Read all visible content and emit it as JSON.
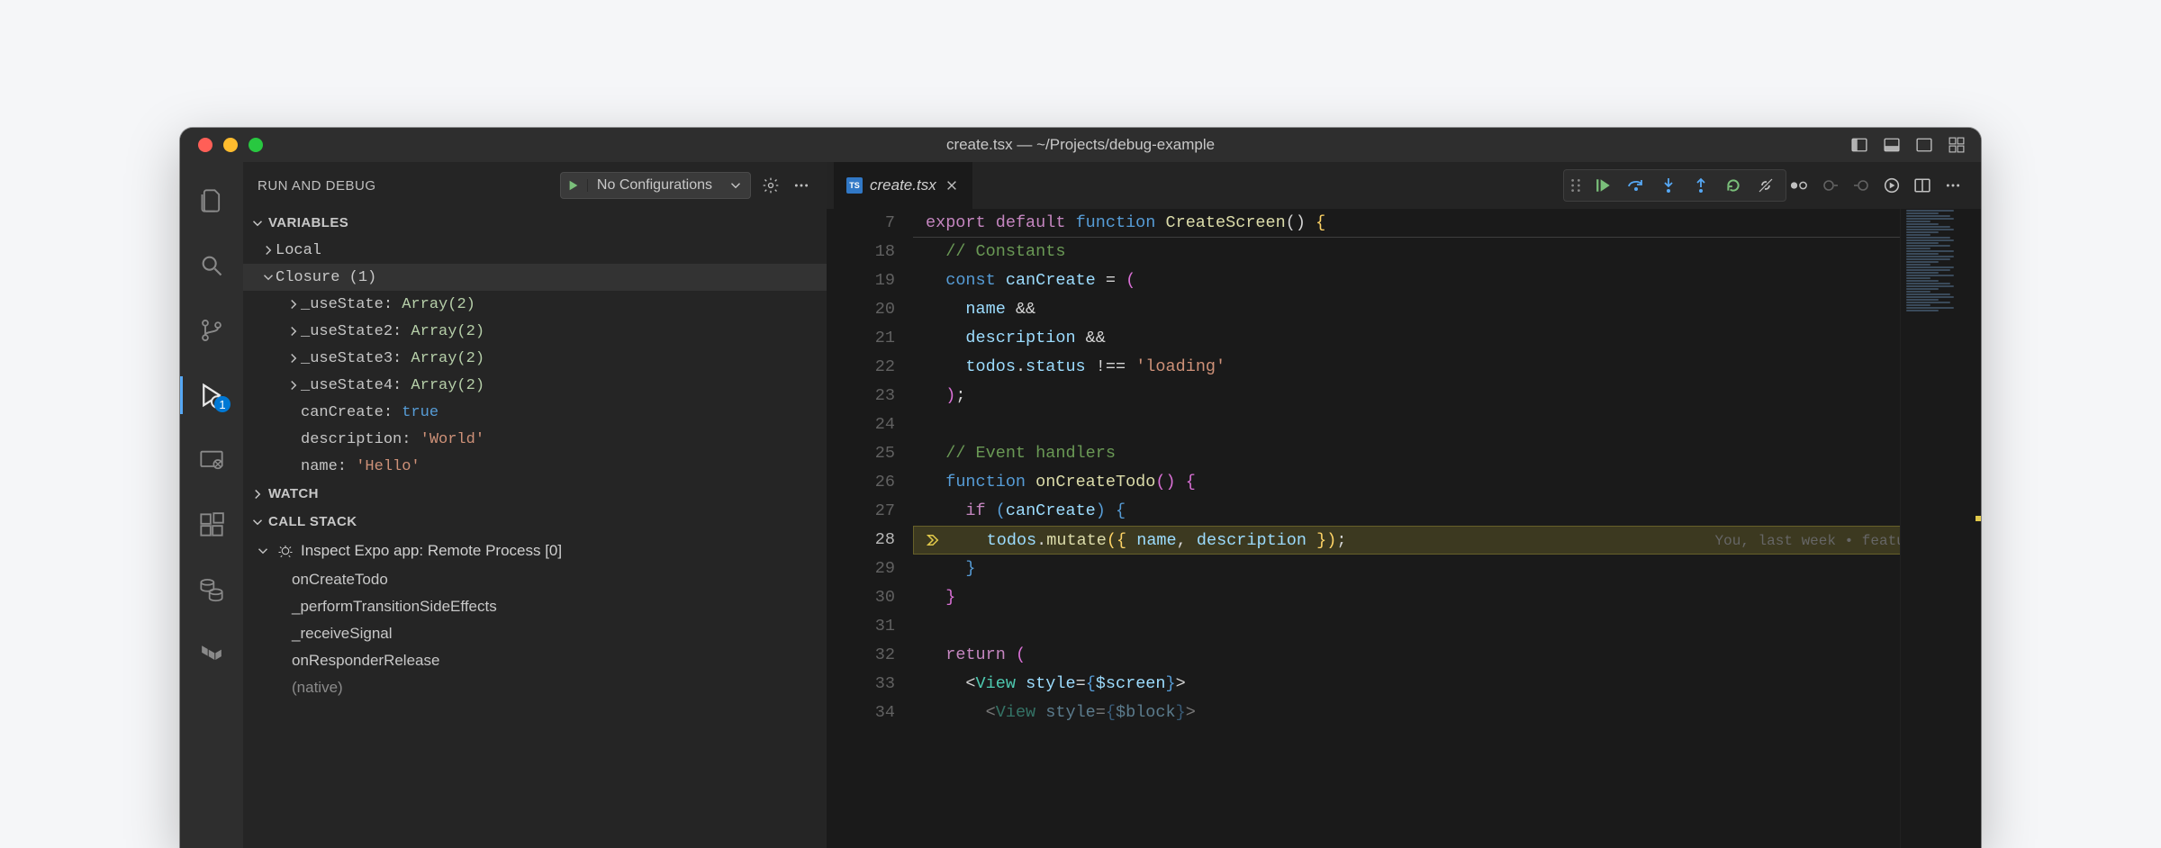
{
  "window": {
    "title": "create.tsx — ~/Projects/debug-example"
  },
  "activity": {
    "badge_debug": "1"
  },
  "sidebar": {
    "title": "Run and Debug",
    "config_label": "No Configurations",
    "sections": {
      "variables": "Variables",
      "watch": "Watch",
      "callstack": "Call Stack"
    },
    "scopes": {
      "local": "Local",
      "closure": "Closure (1)"
    },
    "closure_vars": [
      {
        "name": "_useState:",
        "value": "Array(2)",
        "type": "obj"
      },
      {
        "name": "_useState2:",
        "value": "Array(2)",
        "type": "obj"
      },
      {
        "name": "_useState3:",
        "value": "Array(2)",
        "type": "obj"
      },
      {
        "name": "_useState4:",
        "value": "Array(2)",
        "type": "obj"
      },
      {
        "name": "canCreate:",
        "value": "true",
        "type": "lit"
      },
      {
        "name": "description:",
        "value": "'World'",
        "type": "str"
      },
      {
        "name": "name:",
        "value": "'Hello'",
        "type": "str"
      }
    ],
    "callstack": {
      "process": "Inspect Expo app: Remote Process [0]",
      "frames": [
        "onCreateTodo",
        "_performTransitionSideEffects",
        "_receiveSignal",
        "onResponderRelease",
        "(native)"
      ]
    }
  },
  "tab": {
    "file": "create.tsx"
  },
  "editor": {
    "line_numbers": [
      "7",
      "18",
      "19",
      "20",
      "21",
      "22",
      "23",
      "24",
      "25",
      "26",
      "27",
      "28",
      "29",
      "30",
      "31",
      "32",
      "33",
      "34"
    ],
    "current_line_index": 11,
    "codelens": "You, last week • feature: add",
    "exec_arrow_title": "paused"
  },
  "editor_action_icons": {
    "bp_all": "breakpoints",
    "next": "next",
    "diff": "diff",
    "inspect": "inspect",
    "split": "split",
    "more": "…"
  }
}
